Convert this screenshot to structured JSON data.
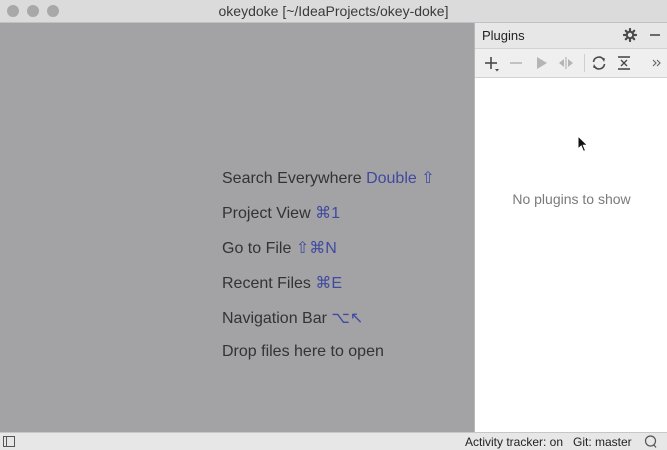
{
  "window": {
    "title": "okeydoke [~/IdeaProjects/okey-doke]"
  },
  "hints": [
    {
      "label": "Search Everywhere",
      "shortcut": "Double ⇧"
    },
    {
      "label": "Project View",
      "shortcut": "⌘1"
    },
    {
      "label": "Go to File",
      "shortcut": "⇧⌘N"
    },
    {
      "label": "Recent Files",
      "shortcut": "⌘E"
    },
    {
      "label": "Navigation Bar",
      "shortcut": "⌥↖"
    },
    {
      "label": "Drop files here to open",
      "shortcut": ""
    }
  ],
  "plugins_panel": {
    "title": "Plugins",
    "empty_text": "No plugins to show",
    "toolbar_icons": [
      "add-icon",
      "remove-icon",
      "run-icon",
      "diff-icon",
      "refresh-icon",
      "collapse-icon",
      "more-icon"
    ]
  },
  "statusbar": {
    "activity": "Activity tracker: on",
    "git": "Git: master"
  },
  "colors": {
    "shortcut": "#3f4aa0",
    "editor_bg": "#a3a2a4"
  }
}
